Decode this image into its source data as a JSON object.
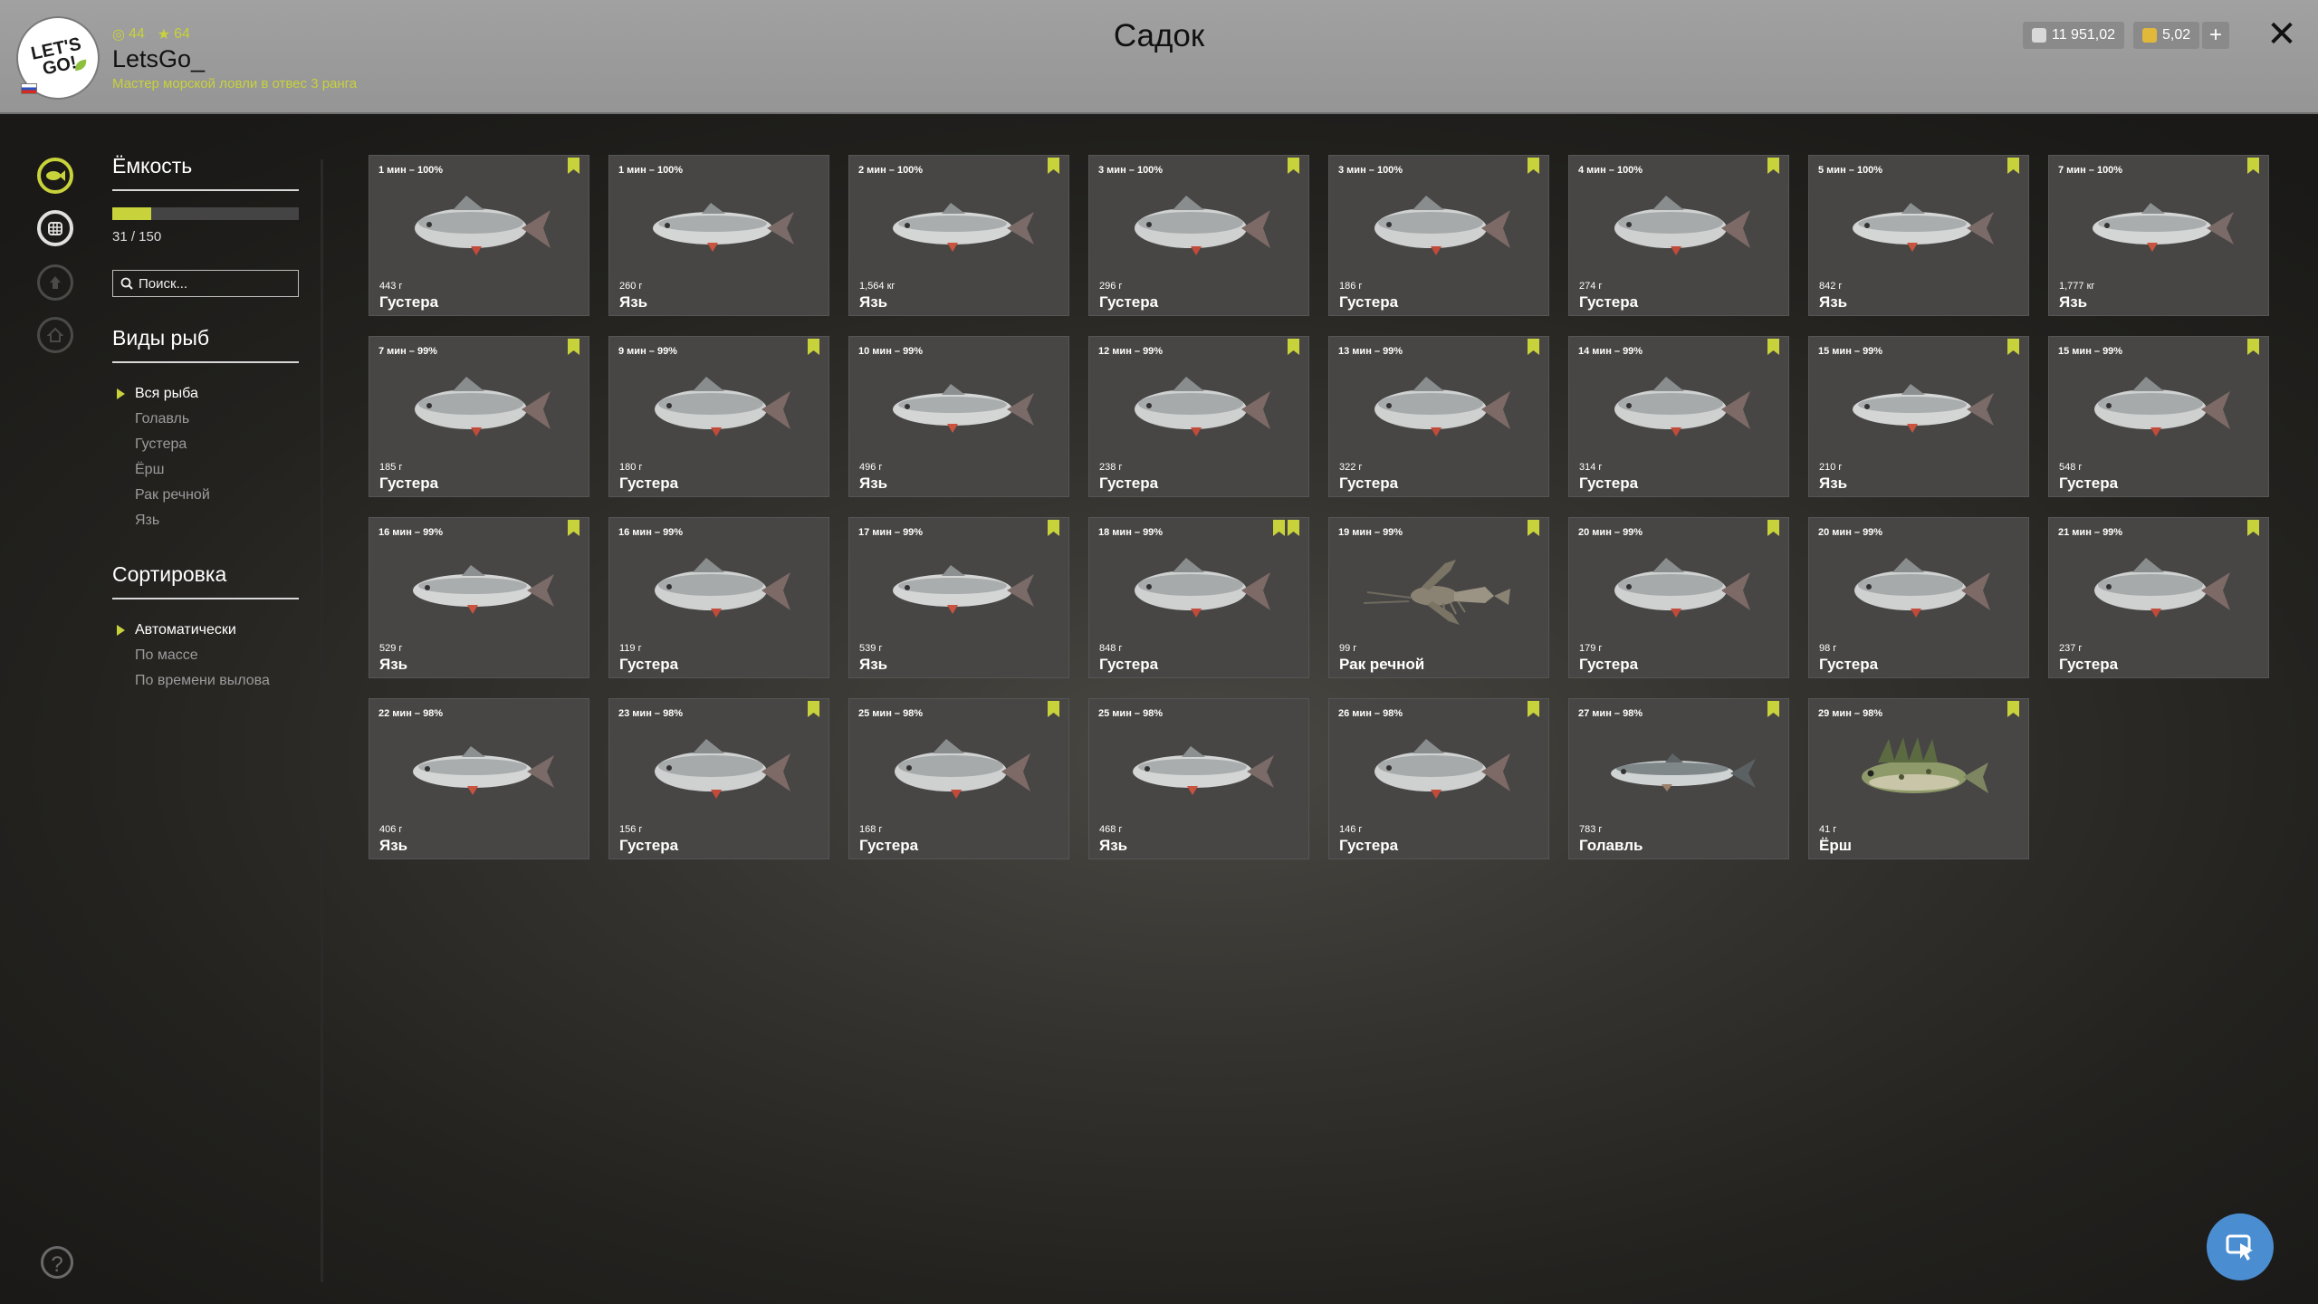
{
  "header": {
    "title": "Садок",
    "username": "LetsGo_",
    "rank": "Мастер морской ловли в отвес 3 ранга",
    "stat_level": "44",
    "stat_stars": "64",
    "logo_text": "LET'S GO!",
    "currency_silver": "11 951,02",
    "currency_gold": "5,02",
    "add_label": "+",
    "close_label": "✕"
  },
  "sidebar": {
    "capacity_title": "Ёмкость",
    "capacity_text": "31 / 150",
    "capacity_fraction": 0.2067,
    "search_placeholder": "Поиск...",
    "species_title": "Виды рыб",
    "species": [
      "Вся рыба",
      "Голавль",
      "Густера",
      "Ёрш",
      "Рак речной",
      "Язь"
    ],
    "sort_title": "Сортировка",
    "sort_options": [
      "Автоматически",
      "По массе",
      "По времени вылова"
    ]
  },
  "icons": {
    "rail": [
      "fish-icon",
      "keepnet-icon",
      "trophy-icon",
      "home-icon"
    ],
    "help": "question-icon",
    "fab": "cursor-icon"
  },
  "colors": {
    "accent": "#c8d23a",
    "card": "#474645",
    "header": "#9b9b9b",
    "fab": "#4a8ed1"
  },
  "catches": [
    {
      "time": "1 мин – 100%",
      "weight": "443 г",
      "species": "Густера",
      "marks": 1,
      "kind": "bream"
    },
    {
      "time": "1 мин – 100%",
      "weight": "260 г",
      "species": "Язь",
      "marks": 0,
      "kind": "ide"
    },
    {
      "time": "2 мин – 100%",
      "weight": "1,564 кг",
      "species": "Язь",
      "marks": 1,
      "kind": "ide"
    },
    {
      "time": "3 мин – 100%",
      "weight": "296 г",
      "species": "Густера",
      "marks": 1,
      "kind": "bream"
    },
    {
      "time": "3 мин – 100%",
      "weight": "186 г",
      "species": "Густера",
      "marks": 1,
      "kind": "bream"
    },
    {
      "time": "4 мин – 100%",
      "weight": "274 г",
      "species": "Густера",
      "marks": 1,
      "kind": "bream"
    },
    {
      "time": "5 мин – 100%",
      "weight": "842 г",
      "species": "Язь",
      "marks": 1,
      "kind": "ide"
    },
    {
      "time": "7 мин – 100%",
      "weight": "1,777 кг",
      "species": "Язь",
      "marks": 1,
      "kind": "ide"
    },
    {
      "time": "7 мин – 99%",
      "weight": "185 г",
      "species": "Густера",
      "marks": 1,
      "kind": "bream"
    },
    {
      "time": "9 мин – 99%",
      "weight": "180 г",
      "species": "Густера",
      "marks": 1,
      "kind": "bream"
    },
    {
      "time": "10 мин – 99%",
      "weight": "496 г",
      "species": "Язь",
      "marks": 0,
      "kind": "ide"
    },
    {
      "time": "12 мин – 99%",
      "weight": "238 г",
      "species": "Густера",
      "marks": 1,
      "kind": "bream"
    },
    {
      "time": "13 мин – 99%",
      "weight": "322 г",
      "species": "Густера",
      "marks": 1,
      "kind": "bream"
    },
    {
      "time": "14 мин – 99%",
      "weight": "314 г",
      "species": "Густера",
      "marks": 1,
      "kind": "bream"
    },
    {
      "time": "15 мин – 99%",
      "weight": "210 г",
      "species": "Язь",
      "marks": 1,
      "kind": "ide"
    },
    {
      "time": "15 мин – 99%",
      "weight": "548 г",
      "species": "Густера",
      "marks": 1,
      "kind": "bream"
    },
    {
      "time": "16 мин – 99%",
      "weight": "529 г",
      "species": "Язь",
      "marks": 1,
      "kind": "ide"
    },
    {
      "time": "16 мин – 99%",
      "weight": "119 г",
      "species": "Густера",
      "marks": 0,
      "kind": "bream"
    },
    {
      "time": "17 мин – 99%",
      "weight": "539 г",
      "species": "Язь",
      "marks": 1,
      "kind": "ide"
    },
    {
      "time": "18 мин – 99%",
      "weight": "848 г",
      "species": "Густера",
      "marks": 2,
      "kind": "bream"
    },
    {
      "time": "19 мин – 99%",
      "weight": "99 г",
      "species": "Рак речной",
      "marks": 1,
      "kind": "crayfish"
    },
    {
      "time": "20 мин – 99%",
      "weight": "179 г",
      "species": "Густера",
      "marks": 1,
      "kind": "bream"
    },
    {
      "time": "20 мин – 99%",
      "weight": "98 г",
      "species": "Густера",
      "marks": 0,
      "kind": "bream"
    },
    {
      "time": "21 мин – 99%",
      "weight": "237 г",
      "species": "Густера",
      "marks": 1,
      "kind": "bream"
    },
    {
      "time": "22 мин – 98%",
      "weight": "406 г",
      "species": "Язь",
      "marks": 0,
      "kind": "ide"
    },
    {
      "time": "23 мин – 98%",
      "weight": "156 г",
      "species": "Густера",
      "marks": 1,
      "kind": "bream"
    },
    {
      "time": "25 мин – 98%",
      "weight": "168 г",
      "species": "Густера",
      "marks": 1,
      "kind": "bream"
    },
    {
      "time": "25 мин – 98%",
      "weight": "468 г",
      "species": "Язь",
      "marks": 0,
      "kind": "ide"
    },
    {
      "time": "26 мин – 98%",
      "weight": "146 г",
      "species": "Густера",
      "marks": 1,
      "kind": "bream"
    },
    {
      "time": "27 мин – 98%",
      "weight": "783 г",
      "species": "Голавль",
      "marks": 1,
      "kind": "chub"
    },
    {
      "time": "29 мин – 98%",
      "weight": "41 г",
      "species": "Ёрш",
      "marks": 1,
      "kind": "ruffe"
    }
  ]
}
